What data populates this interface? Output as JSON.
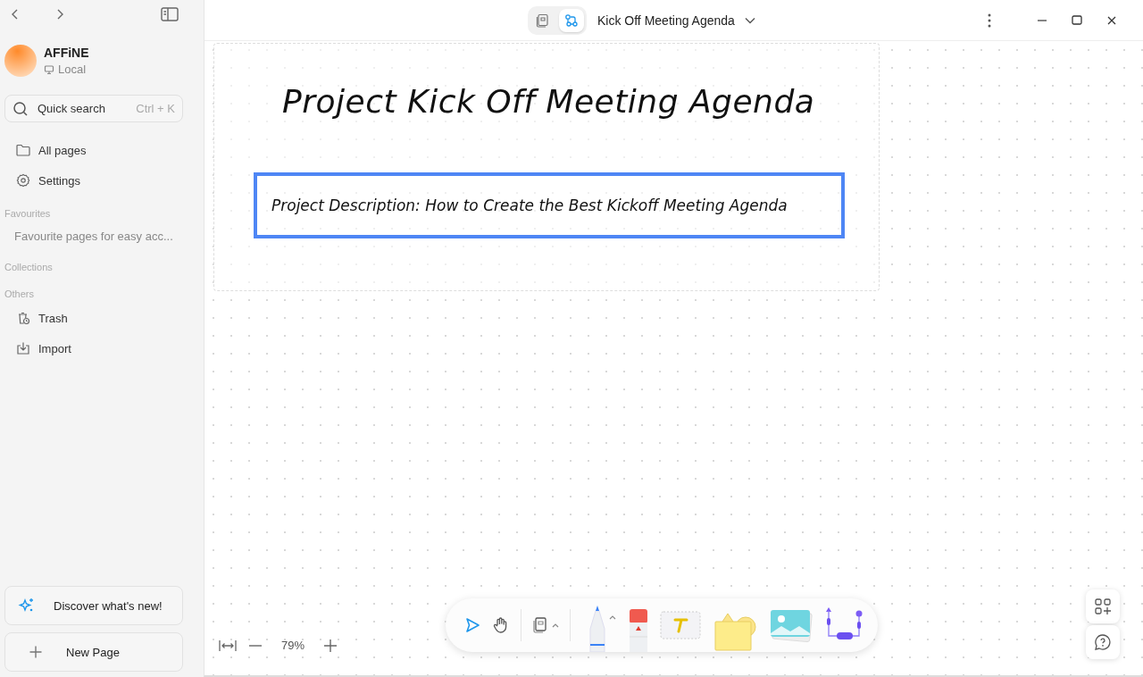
{
  "sidebar": {
    "workspace": {
      "name": "AFFiNE",
      "storage": "Local"
    },
    "search": {
      "label": "Quick search",
      "shortcut": "Ctrl + K"
    },
    "items": [
      {
        "kind": "folder",
        "label": "All pages"
      },
      {
        "kind": "settings",
        "label": "Settings"
      }
    ],
    "sections": [
      {
        "title": "Favourites",
        "items": [
          {
            "kind": "placeholder",
            "label": "Favourite pages for easy acc..."
          }
        ]
      },
      {
        "title": "Collections"
      },
      {
        "title": "Others",
        "items": [
          {
            "kind": "trash",
            "label": "Trash"
          },
          {
            "kind": "import",
            "label": "Import"
          }
        ]
      }
    ],
    "discover": "Discover what's new!",
    "new_page": "New Page"
  },
  "header": {
    "modes": [
      {
        "kind": "page",
        "selected": false
      },
      {
        "kind": "edgeless",
        "selected": true
      }
    ],
    "title": "Kick Off Meeting Agenda"
  },
  "canvas": {
    "title": "Project Kick Off Meeting Agenda",
    "description": "Project Description: How to Create the Best Kickoff Meeting Agenda"
  },
  "zoom": {
    "value": "79%"
  },
  "tools": [
    {
      "kind": "select",
      "selected": true
    },
    {
      "kind": "hand",
      "selected": false
    },
    {
      "kind": "note",
      "selected": false
    }
  ]
}
